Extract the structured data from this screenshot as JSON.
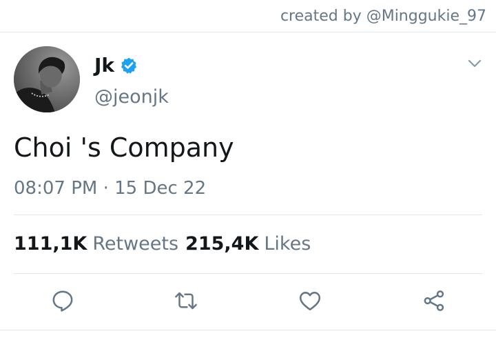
{
  "credit": "created by @Minggukie_97",
  "tweet": {
    "display_name": "Jk",
    "handle": "@jeonjk",
    "verified": true,
    "text": "Choi 's Company",
    "timestamp": "08:07 PM · 15 Dec 22"
  },
  "stats": {
    "retweets_count": "111,1K",
    "retweets_label": "Retweets",
    "likes_count": "215,4K",
    "likes_label": "Likes"
  },
  "icons": {
    "verified": "verified-badge-icon",
    "more": "chevron-down-icon",
    "reply": "reply-icon",
    "retweet": "retweet-icon",
    "like": "heart-icon",
    "share": "share-icon"
  },
  "colors": {
    "verified_blue": "#1da1f2",
    "secondary_text": "#657786",
    "primary_text": "#14171a",
    "icon_gray": "#657786"
  }
}
